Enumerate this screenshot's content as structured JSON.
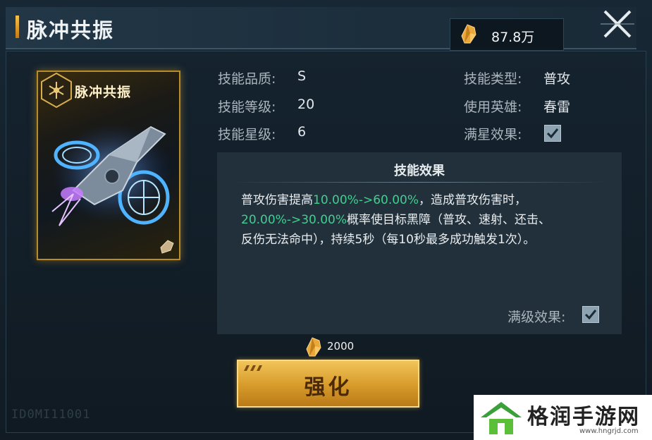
{
  "header": {
    "title": "脉冲共振",
    "currency_value": "87.8万",
    "currency_icon": "crystal-icon",
    "close_icon": "close-icon"
  },
  "card": {
    "title": "脉冲共振",
    "emblem_icon": "hexagon-emblem-icon",
    "art": "drone-art"
  },
  "info": {
    "quality_label": "技能品质:",
    "quality_value": "S",
    "level_label": "技能等级:",
    "level_value": "20",
    "star_label": "技能星级:",
    "star_value": "6",
    "type_label": "技能类型:",
    "type_value": "普攻",
    "hero_label": "使用英雄:",
    "hero_value": "春雷",
    "max_star_label": "满星效果:",
    "max_star_checked": true
  },
  "effect": {
    "title": "技能效果",
    "line1_a": "普攻伤害提高",
    "line1_b": "10.00%->60.00%",
    "line1_c": "，造成普攻伤害时，",
    "line2_a": "20.00%->30.00%",
    "line2_b": "概率使目标黑障（普攻、速射、还击、",
    "line3": "反伤无法命中），持续5秒（每10秒最多成功触发1次）。",
    "max_level_label": "满级效果:",
    "max_level_checked": true,
    "highlight_color": "#3fd090"
  },
  "upgrade": {
    "cost": "2000",
    "cost_icon": "crystal-icon",
    "button_label": "强化"
  },
  "footer": {
    "id_text": "ID0MI11001"
  },
  "watermark": {
    "name": "格润手游网",
    "url": "www.hngrjd.com"
  }
}
